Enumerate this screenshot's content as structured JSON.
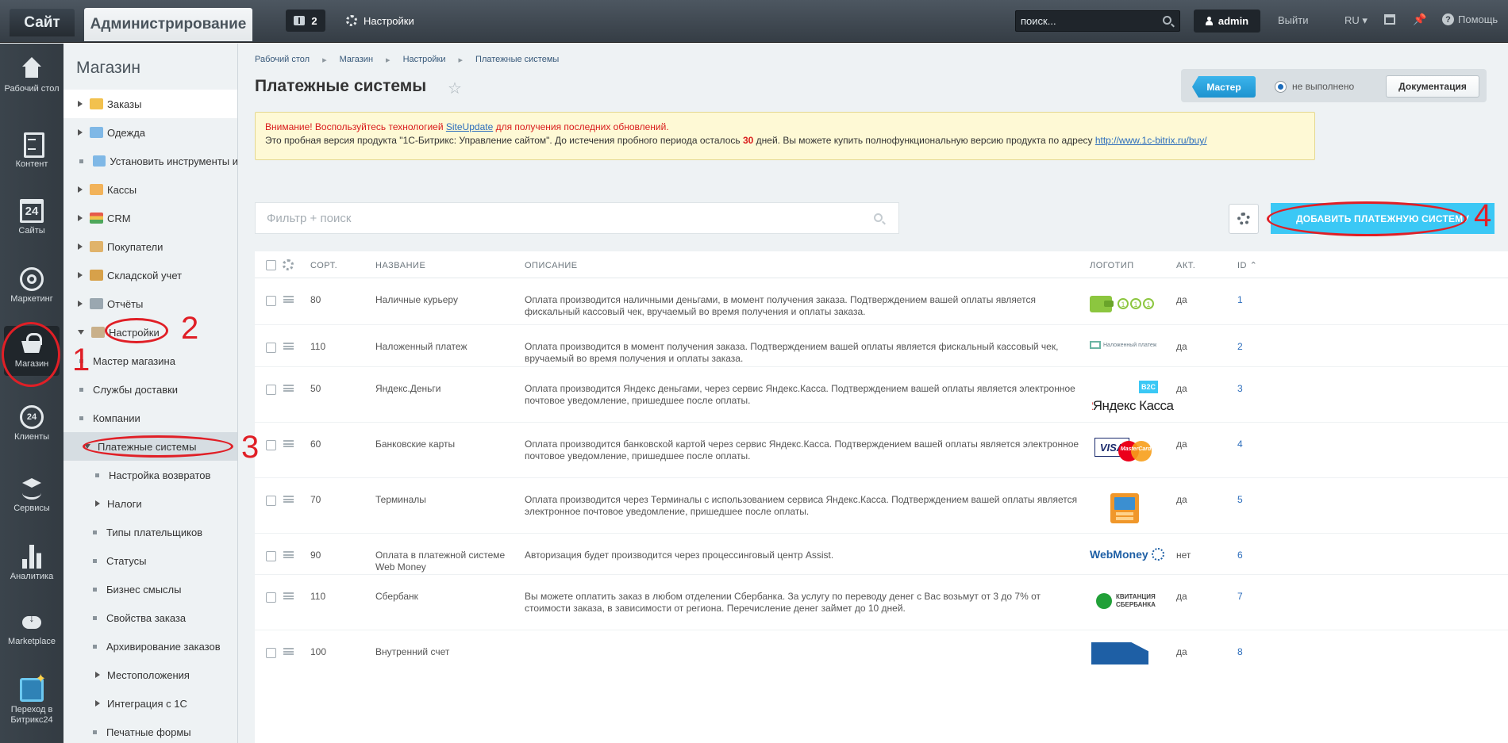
{
  "topbar": {
    "tab_site": "Сайт",
    "tab_admin": "Администрирование",
    "notifications_count": "2",
    "settings_label": "Настройки",
    "search_value": "поиск...",
    "user_label": "admin",
    "logout_label": "Выйти",
    "lang_label": "RU",
    "help_label": "Помощь"
  },
  "iconbar": [
    {
      "label": "Рабочий стол",
      "icon": "house-icon"
    },
    {
      "label": "Контент",
      "icon": "document-icon"
    },
    {
      "label": "Сайты",
      "icon": "calendar-icon",
      "badge": "24"
    },
    {
      "label": "Маркетинг",
      "icon": "target-icon"
    },
    {
      "label": "Магазин",
      "icon": "basket-icon"
    },
    {
      "label": "Клиенты",
      "icon": "clients-icon",
      "badge": "24"
    },
    {
      "label": "Сервисы",
      "icon": "layers-icon"
    },
    {
      "label": "Аналитика",
      "icon": "bar-chart-icon"
    },
    {
      "label": "Marketplace",
      "icon": "cloud-download-icon"
    },
    {
      "label": "Переход в Битрикс24",
      "icon": "bitrix24-icon"
    }
  ],
  "tree": {
    "title": "Магазин",
    "items": [
      {
        "label": "Заказы"
      },
      {
        "label": "Одежда"
      },
      {
        "label": "Установить инструменты и"
      },
      {
        "label": "Кассы"
      },
      {
        "label": "CRM"
      },
      {
        "label": "Покупатели"
      },
      {
        "label": "Складской учет"
      },
      {
        "label": "Отчёты"
      },
      {
        "label": "Настройки"
      },
      {
        "label": "Мастер магазина"
      },
      {
        "label": "Службы доставки"
      },
      {
        "label": "Компании"
      },
      {
        "label": "Платежные системы"
      },
      {
        "label": "Настройка возвратов"
      },
      {
        "label": "Налоги"
      },
      {
        "label": "Типы плательщиков"
      },
      {
        "label": "Статусы"
      },
      {
        "label": "Бизнес смыслы"
      },
      {
        "label": "Свойства заказа"
      },
      {
        "label": "Архивирование заказов"
      },
      {
        "label": "Местоположения"
      },
      {
        "label": "Интеграция с 1С"
      },
      {
        "label": "Печатные формы"
      }
    ]
  },
  "breadcrumbs": [
    "Рабочий стол",
    "Магазин",
    "Настройки",
    "Платежные системы"
  ],
  "page_title": "Платежные системы",
  "master": {
    "button": "Мастер",
    "status": "не выполнено",
    "docs_button": "Документация"
  },
  "warning": {
    "line1_pre": "Внимание! Воспользуйтесь технологией ",
    "line1_link": "SiteUpdate",
    "line1_post": " для получения последних обновлений.",
    "line2_pre": "Это пробная версия продукта \"1С-Битрикс: Управление сайтом\". До истечения пробного периода осталось ",
    "line2_days": "30",
    "line2_mid": " дней. Вы можете купить полнофункциональную версию продукта по адресу ",
    "line2_link": "http://www.1c-bitrix.ru/buy/"
  },
  "filter": {
    "placeholder": "Фильтр + поиск"
  },
  "add_button": "ДОБАВИТЬ ПЛАТЕЖНУЮ СИСТЕМУ",
  "grid": {
    "columns": {
      "sort": "СОРТ.",
      "name": "НАЗВАНИЕ",
      "desc": "ОПИСАНИЕ",
      "logo": "ЛОГОТИП",
      "active": "АКТ.",
      "id": "ID"
    },
    "rows": [
      {
        "sort": "80",
        "name": "Наличные курьеру",
        "desc": "Оплата производится наличными деньгами, в момент получения заказа. Подтверждением вашей оплаты является фискальный кассовый чек, вручаемый во время получения и оплаты заказа.",
        "logo": "cash-wallet-icon",
        "active": "да",
        "id": "1"
      },
      {
        "sort": "110",
        "name": "Наложенный платеж",
        "desc": "Оплата производится в момент получения заказа. Подтверждением вашей оплаты является фискальный кассовый чек, вручаемый во время получения и оплаты заказа.",
        "logo": "cod-icon",
        "logo_text": "Наложенный платеж",
        "active": "да",
        "id": "2"
      },
      {
        "sort": "50",
        "name": "Яндекс.Деньги",
        "desc": "Оплата производится Яндекс деньгами, через сервис Яндекс.Касса. Подтверждением вашей оплаты является электронное почтовое уведомление, пришедшее после оплаты.",
        "logo": "yandex-kassa-logo",
        "logo_text": "Яндекс Касса",
        "logo_badge": "B2C",
        "active": "да",
        "id": "3"
      },
      {
        "sort": "60",
        "name": "Банковские карты",
        "desc": "Оплата производится банковской картой через сервис Яндекс.Касса. Подтверждением вашей оплаты является электронное почтовое уведомление, пришедшее после оплаты.",
        "logo": "visa-mastercard-logo",
        "logo_text": "VISA",
        "logo_text2": "MasterCard",
        "active": "да",
        "id": "4"
      },
      {
        "sort": "70",
        "name": "Терминалы",
        "desc": "Оплата производится через Терминалы с использованием сервиса Яндекс.Касса. Подтверждением вашей оплаты является электронное почтовое уведомление, пришедшее после оплаты.",
        "logo": "terminal-icon",
        "active": "да",
        "id": "5"
      },
      {
        "sort": "90",
        "name": "Оплата в платежной системе Web Money",
        "desc": "Авторизация будет производится через процессинговый центр Assist.",
        "logo": "webmoney-logo",
        "logo_text": "WebMoney",
        "active": "нет",
        "id": "6"
      },
      {
        "sort": "110",
        "name": "Сбербанк",
        "desc": "Вы можете оплатить заказ в любом отделении Сбербанка. За услугу по переводу денег с Вас возьмут от 3 до 7% от стоимости заказа, в зависимости от региона. Перечисление денег займет до 10 дней.",
        "logo": "sberbank-logo",
        "logo_text": "КВИТАНЦИЯ",
        "logo_text2": "СБЕРБАНКА",
        "active": "да",
        "id": "7"
      },
      {
        "sort": "100",
        "name": "Внутренний счет",
        "desc": "",
        "logo": "account-icon",
        "active": "да",
        "id": "8"
      }
    ]
  },
  "annotations": [
    "1",
    "2",
    "3",
    "4"
  ],
  "colors": {
    "accent": "#3bc8f5",
    "annotation": "#e01f26",
    "link": "#2c6dbc"
  }
}
